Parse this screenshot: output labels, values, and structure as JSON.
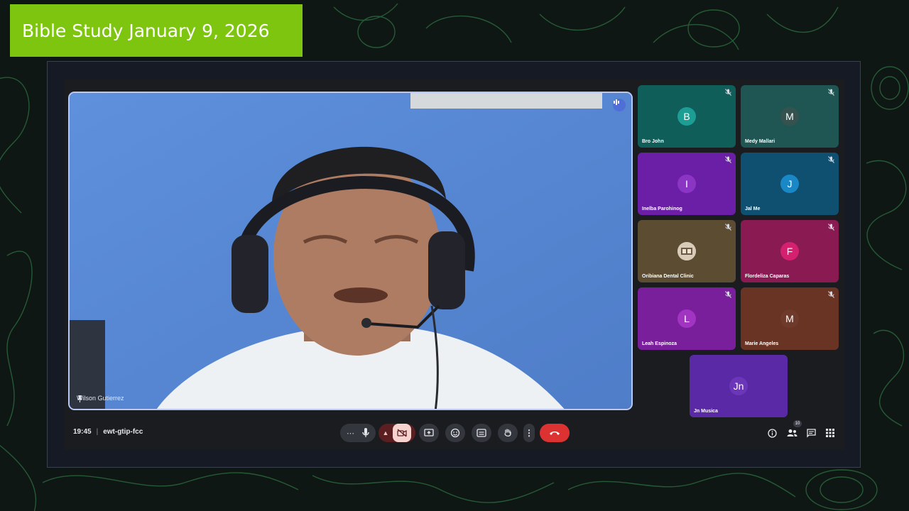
{
  "banner": {
    "title": "Bible Study January 9, 2026"
  },
  "speaker": {
    "name": "Wilson Gutierrez"
  },
  "participants": [
    {
      "initial": "B",
      "name": "Bro John",
      "tile_color": "#0f5e5a",
      "avatar_color": "#1d9e94",
      "muted": true
    },
    {
      "initial": "M",
      "name": "Medy Mallari",
      "tile_color": "#1f5553",
      "avatar_color": "#36524f",
      "muted": true
    },
    {
      "initial": "I",
      "name": "Inelba Parohinog",
      "tile_color": "#6a1fa6",
      "avatar_color": "#8a35c4",
      "muted": true
    },
    {
      "initial": "J",
      "name": "Jal Me",
      "tile_color": "#0f4f70",
      "avatar_color": "#1a87c6",
      "muted": true
    },
    {
      "initial": "",
      "name": "Oribiana Dental Clinic",
      "tile_color": "#5c4d32",
      "avatar_color": "#c9b79b",
      "muted": true
    },
    {
      "initial": "F",
      "name": "Flordeliza Caparas",
      "tile_color": "#8a1a52",
      "avatar_color": "#d4206f",
      "muted": true
    },
    {
      "initial": "L",
      "name": "Leah Espinoza",
      "tile_color": "#7a1f9c",
      "avatar_color": "#a135c2",
      "muted": true
    },
    {
      "initial": "M",
      "name": "Marie Angeles",
      "tile_color": "#6a3424",
      "avatar_color": "#6e3a2c",
      "muted": true
    },
    {
      "initial": "Jn",
      "name": "Jn Musica",
      "tile_color": "#5a2aa6",
      "avatar_color": "#6c36b8",
      "muted": false
    }
  ],
  "meeting": {
    "time": "19:45",
    "separator": "|",
    "code": "ewt-gtip-fcc"
  },
  "participant_count": "10",
  "colors": {
    "banner": "#7ec510",
    "end_call": "#dc3232",
    "camera_off": "#f7d3d0"
  },
  "icons": {
    "more_options": "more-horiz-icon",
    "mic": "mic-icon",
    "camera": "camera-off-icon",
    "present": "present-icon",
    "emoji": "emoji-icon",
    "captions": "captions-icon",
    "hand": "raise-hand-icon",
    "menu": "more-vert-icon",
    "end": "end-call-icon",
    "info": "info-icon",
    "people": "people-icon",
    "chat": "chat-icon",
    "activities": "activities-icon"
  }
}
